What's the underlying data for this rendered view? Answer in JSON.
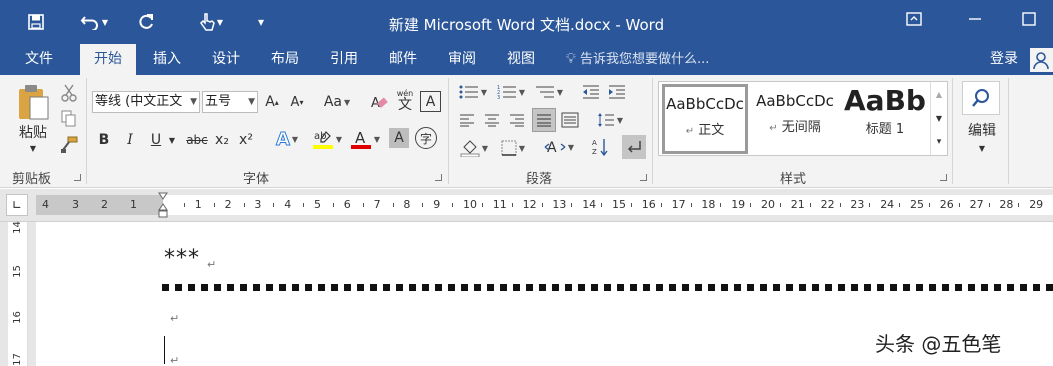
{
  "window": {
    "title": "新建 Microsoft Word 文档.docx - Word"
  },
  "tabs": [
    {
      "label": "文件"
    },
    {
      "label": "开始"
    },
    {
      "label": "插入"
    },
    {
      "label": "设计"
    },
    {
      "label": "布局"
    },
    {
      "label": "引用"
    },
    {
      "label": "邮件"
    },
    {
      "label": "审阅"
    },
    {
      "label": "视图"
    }
  ],
  "tell_me": "告诉我您想要做什么...",
  "login_label": "登录",
  "ribbon": {
    "clipboard": {
      "paste_label": "粘贴",
      "group_label": "剪贴板"
    },
    "font": {
      "font_name": "等线 (中文正文",
      "font_size": "五号",
      "bold": "B",
      "italic": "I",
      "underline": "U",
      "strike": "abc",
      "subscript": "x₂",
      "superscript": "x²",
      "case_label": "Aa",
      "pinyin_label": "wén",
      "group_label": "字体"
    },
    "paragraph": {
      "group_label": "段落"
    },
    "styles": {
      "items": [
        {
          "sample": "AaBbCcDc",
          "name": "正文"
        },
        {
          "sample": "AaBbCcDc",
          "name": "无间隔"
        },
        {
          "sample": "AaBb",
          "name": "标题 1"
        }
      ],
      "group_label": "样式"
    },
    "editing": {
      "label": "编辑"
    }
  },
  "ruler": {
    "left_ticks": [
      "4",
      "3",
      "2",
      "1"
    ],
    "ticks": [
      "1",
      "2",
      "3",
      "4",
      "5",
      "6",
      "7",
      "8",
      "9",
      "10",
      "11",
      "12",
      "13",
      "14",
      "15",
      "16",
      "17",
      "18",
      "19",
      "20",
      "21",
      "22",
      "23",
      "24",
      "25",
      "26",
      "27",
      "28",
      "29"
    ],
    "vertical_ticks": [
      "14",
      "15",
      "16",
      "17"
    ]
  },
  "document": {
    "line1": "***"
  },
  "watermark": "头条 @五色笔",
  "colors": {
    "brand": "#2b579a",
    "highlight": "#ffff00",
    "font_color": "#e00000"
  }
}
